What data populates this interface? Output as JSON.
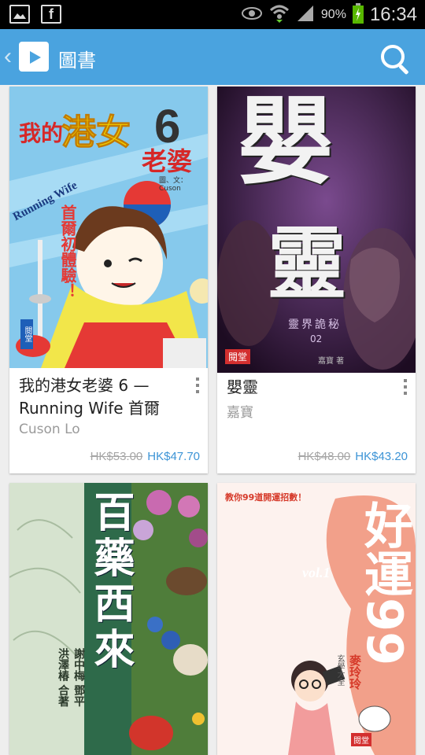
{
  "status_bar": {
    "battery": "90%",
    "time": "16:34"
  },
  "action_bar": {
    "title": "圖書"
  },
  "books": [
    {
      "title": "我的港女老婆 6 — Running Wife 首爾",
      "author": "Cuson Lo",
      "old_price": "HK$53.00",
      "price": "HK$47.70",
      "cover": {
        "t1": "我的",
        "t2": "港女",
        "t3": "老婆",
        "num": "6",
        "credit": "圖、文：Cuson",
        "sub": "Running Wife",
        "red": "首爾初體驗！",
        "logo": "閱堂"
      }
    },
    {
      "title": "嬰靈",
      "author": "嘉寶",
      "old_price": "HK$48.00",
      "price": "HK$43.20",
      "cover": {
        "t1": "嬰",
        "t2": "靈",
        "series": "靈界詭秘",
        "vol": "02",
        "logo": "閱堂",
        "author": "嘉寶 著"
      }
    },
    {
      "cover": {
        "title": "百藥西來",
        "line1": "謝中梅 鄧平",
        "line2": "洪澤椿 合著"
      }
    },
    {
      "cover": {
        "head": "教你99道開運招數！",
        "title": "好運99",
        "vol": "vol.1",
        "author": "麥玲玲",
        "series": "玄學大全",
        "logo": "閱堂"
      }
    }
  ],
  "colors": {
    "action_bar": "#4aa3df",
    "price": "#3d94d6",
    "strike": "#a5a5a5"
  }
}
